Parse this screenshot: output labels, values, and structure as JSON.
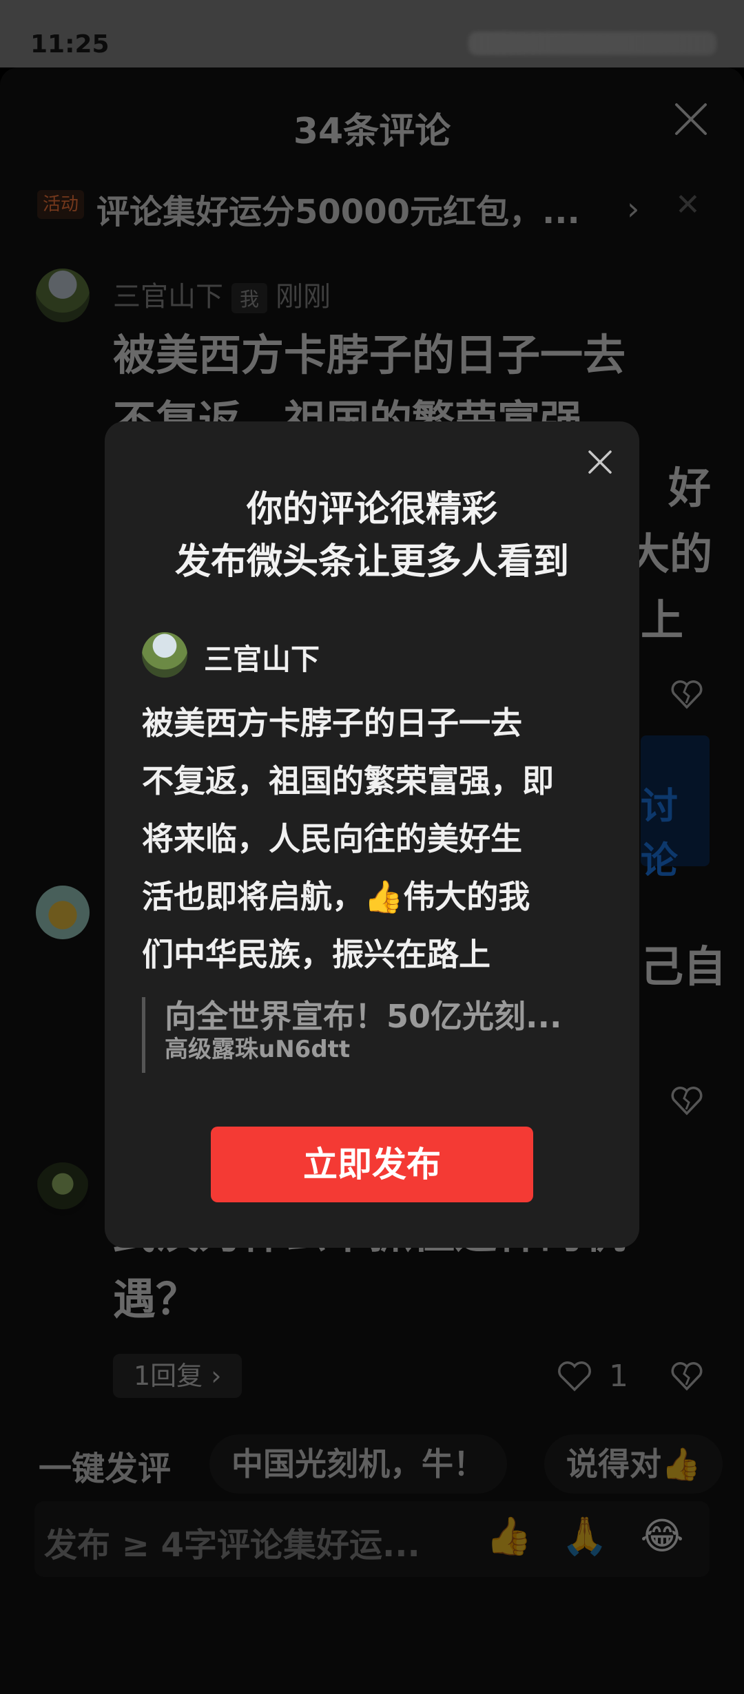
{
  "status_bar": {
    "time": "11:25"
  },
  "sheet": {
    "title": "34条评论"
  },
  "promo": {
    "tag": "活动",
    "text": "评论集好运分50000元红包，...",
    "chevron": "›",
    "close": "✕"
  },
  "comment1": {
    "author": "三官山下",
    "me_badge": "我",
    "time": "刚刚",
    "text": "被美西方卡脖子的日子一去不复返，祖国的繁荣富强，即将来临，人民向往的美好生活也即将启航，👍伟大的我们中华民族，振兴在路上",
    "fragments": [
      "被美西方卡脖子的日子一去",
      "不复返，祖国的繁荣富强，",
      "好",
      "大的",
      "上"
    ]
  },
  "comment2": {
    "fragment": "己自",
    "blue_fragment": "讨论"
  },
  "comment3": {
    "text_lines": [
      "武汉为什么不抓住这样的机",
      "遇？"
    ],
    "reply_label": "1回复 ›",
    "likes": "1"
  },
  "quick_comments": {
    "label": "一键发评",
    "chips": [
      "中国光刻机，牛！",
      "说得对👍"
    ]
  },
  "input": {
    "placeholder": "发布 ≥ 4字评论集好运...",
    "emojis": [
      "👍",
      "🙏",
      "😂"
    ]
  },
  "modal": {
    "title_line1": "你的评论很精彩",
    "title_line2": "发布微头条让更多人看到",
    "author": "三官山下",
    "body_lines": [
      "被美西方卡脖子的日子一去",
      "不复返，祖国的繁荣富强，即",
      "将来临，人民向往的美好生",
      "活也即将启航，👍伟大的我",
      "们中华民族，振兴在路上"
    ],
    "quote_title": "向全世界宣布！50亿光刻...",
    "quote_source": "高级露珠uN6dtt",
    "publish_button": "立即发布"
  },
  "nav": {
    "icons": [
      "menu-icon",
      "home-square-icon",
      "back-icon"
    ]
  }
}
